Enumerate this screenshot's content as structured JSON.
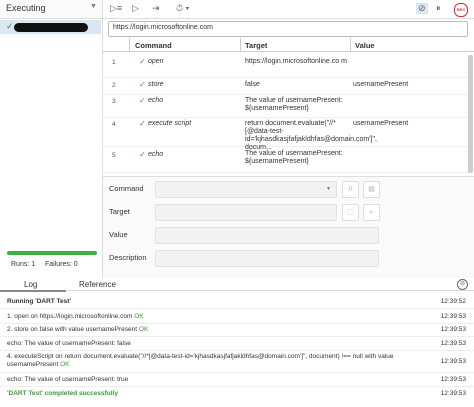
{
  "left_panel": {
    "executing_label": "Executing",
    "runs_label": "Runs: 1",
    "failures_label": "Failures: 0",
    "progress": 1.0
  },
  "toolbar": {
    "record_label": "REC"
  },
  "url": "https://login.microsoftonline.com",
  "table": {
    "headers": [
      "Command",
      "Target",
      "Value"
    ],
    "rows": [
      {
        "num": "1",
        "command": "open",
        "target": "https://login.microsoftonline.co m",
        "value": ""
      },
      {
        "num": "2",
        "command": "store",
        "target": "false",
        "value": "usernamePresent"
      },
      {
        "num": "3",
        "command": "echo",
        "target": "The value of usernamePresent: ${usernamePresent}",
        "value": ""
      },
      {
        "num": "4",
        "command": "execute script",
        "target": "return document.evaluate(\"//*[@data-test-id='kjhasdkasjfafjakldhfas@domain.com']\", docum...",
        "value": "usernamePresent"
      },
      {
        "num": "5",
        "command": "echo",
        "target": "The value of usernamePresent: ${usernamePresent}",
        "value": ""
      }
    ]
  },
  "editor": {
    "command_label": "Command",
    "target_label": "Target",
    "value_label": "Value",
    "description_label": "Description"
  },
  "log_panel": {
    "tab_log": "Log",
    "tab_reference": "Reference",
    "entries": [
      {
        "text": "Running 'DART Test'",
        "time": "12:39:52"
      },
      {
        "text": "1.  open on https://login.microsoftonline.com",
        "status": "OK",
        "time": "12:39:53"
      },
      {
        "text": "2.  store on false with value usernamePresent",
        "status": "OK",
        "time": "12:39:53"
      },
      {
        "text": "echo: The value of usernamePresent: false",
        "time": "12:39:53"
      },
      {
        "text": "4.  executeScript on return document.evaluate(\"//*[@data-test-id='kjhasdkasjfafjakldhfas@domain.com']\", document) !== null with value usernamePresent",
        "status": "OK",
        "time": "12:39:53"
      },
      {
        "text": "echo: The value of usernamePresent: true",
        "time": "12:39:53"
      },
      {
        "text": "'DART Test' completed successfully",
        "time": "12:39:53"
      }
    ]
  },
  "colors": {
    "accent_green": "#3a9b3a",
    "progress_green": "#3cb043",
    "selected_row": "#dbe6f5"
  }
}
